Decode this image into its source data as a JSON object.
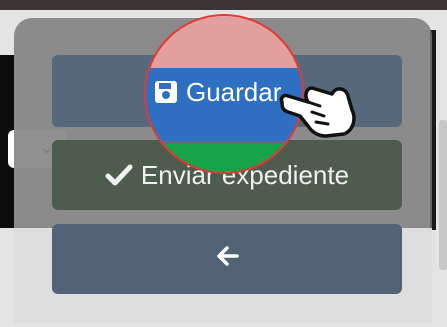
{
  "buttons": {
    "save_label": "Guardar",
    "send_label": "Enviar expediente",
    "back_icon": "arrow-left-icon"
  },
  "icons": {
    "save": "floppy-disk-icon",
    "send": "checkmark-icon",
    "cursor": "hand-pointer-icon",
    "select": "chevron-down-icon"
  },
  "colors": {
    "highlight_ring": "#e53935",
    "save_blue": "#2f6fc1",
    "success_green": "#16a34a"
  }
}
